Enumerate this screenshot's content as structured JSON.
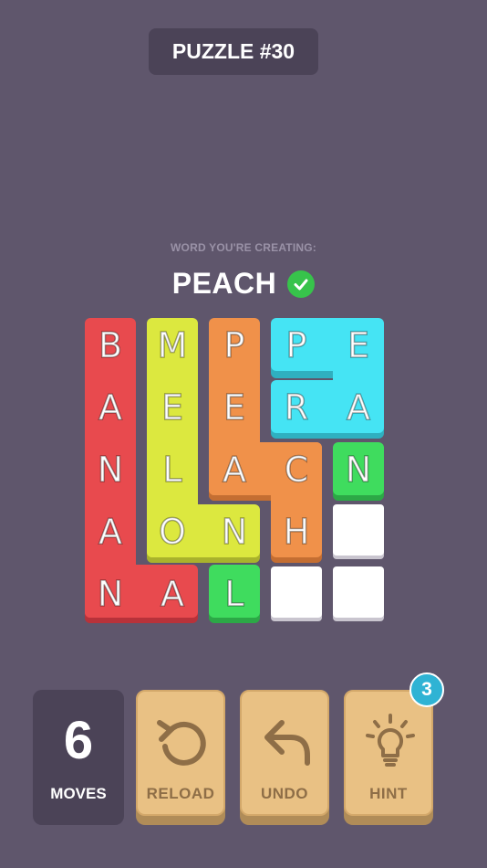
{
  "header": {
    "title": "PUZZLE #30"
  },
  "word_prompt": {
    "label": "WORD YOU'RE CREATING:",
    "word": "PEACH",
    "solved_icon": "check-circle-icon"
  },
  "board": {
    "rows": [
      [
        "B",
        "M",
        "P",
        "P",
        "E"
      ],
      [
        "A",
        "E",
        "E",
        "R",
        "A"
      ],
      [
        "N",
        "L",
        "A",
        "C",
        "N"
      ],
      [
        "A",
        "O",
        "N",
        "H",
        ""
      ],
      [
        "N",
        "A",
        "L",
        "",
        ""
      ]
    ],
    "piece_colors": {
      "red": "#e84a4e",
      "yellow": "#dce83f",
      "orange": "#f0914a",
      "cyan": "#45e4f4",
      "green": "#3fdc5e"
    }
  },
  "controls": {
    "moves": {
      "value": "6",
      "label": "MOVES"
    },
    "reload": {
      "label": "RELOAD",
      "icon": "reload-icon"
    },
    "undo": {
      "label": "UNDO",
      "icon": "undo-arrow-icon"
    },
    "hint": {
      "label": "HINT",
      "icon": "lightbulb-icon",
      "badge": "3"
    }
  }
}
